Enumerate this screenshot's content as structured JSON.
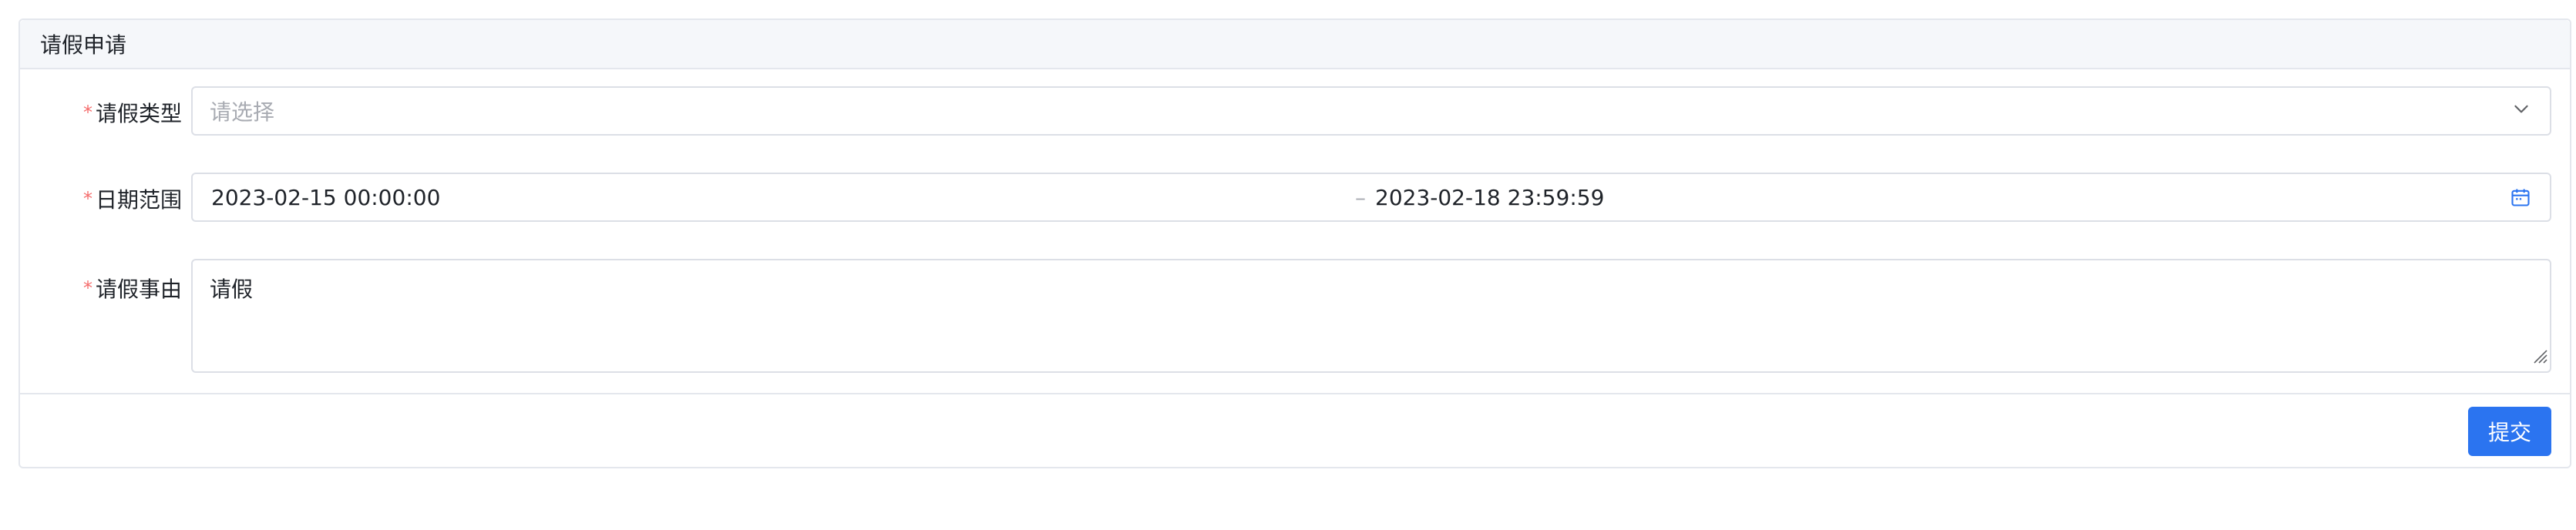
{
  "card": {
    "title": "请假申请"
  },
  "form": {
    "leave_type": {
      "required_mark": "*",
      "label": "请假类型",
      "placeholder": "请选择",
      "icon": "chevron-down-icon"
    },
    "date_range": {
      "required_mark": "*",
      "label": "日期范围",
      "start": "2023-02-15 00:00:00",
      "separator": "–",
      "end": "2023-02-18 23:59:59",
      "icon": "calendar-icon"
    },
    "reason": {
      "required_mark": "*",
      "label": "请假事由",
      "value": "请假"
    }
  },
  "footer": {
    "submit_label": "提交"
  },
  "colors": {
    "primary": "#2b74f0",
    "required": "#f56c6c",
    "border": "#dcdfe6",
    "header_bg": "#f5f7fa",
    "placeholder": "#a8abb2"
  }
}
